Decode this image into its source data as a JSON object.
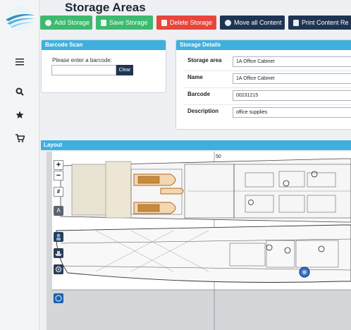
{
  "page": {
    "title": "Storage Areas"
  },
  "sidebar": {
    "icons": [
      "menu-icon",
      "search-icon",
      "star-icon",
      "cart-icon"
    ]
  },
  "toolbar": {
    "add_storage": "Add Storage",
    "save_storage": "Save Storage",
    "delete_storage": "Delete Storage",
    "move_all_content": "Move all Content",
    "print_content": "Print Content Re",
    "colors": {
      "add": "#3cba6e",
      "save": "#3cba6e",
      "delete": "#e8453c",
      "move": "#1e3552",
      "print": "#1e3552"
    }
  },
  "barcode_scan": {
    "header": "Barcode Scan",
    "prompt": "Please enter a barcode:",
    "input_value": "",
    "clear_label": "Clear"
  },
  "storage_details": {
    "header": "Storage Details",
    "storage_area_label": "Storage area",
    "storage_area_value": "1A Office Cabinet",
    "name_label": "Name",
    "name_value": "1A Office Cabinet",
    "barcode_label": "Barcode",
    "barcode_value": "00231215",
    "description_label": "Description",
    "description_value": "office supplies"
  },
  "layout": {
    "header": "Layout",
    "frame_number": "50",
    "zoom_in": "+",
    "zoom_out": "−",
    "grid_label": "#",
    "text_tool_label": "A"
  }
}
